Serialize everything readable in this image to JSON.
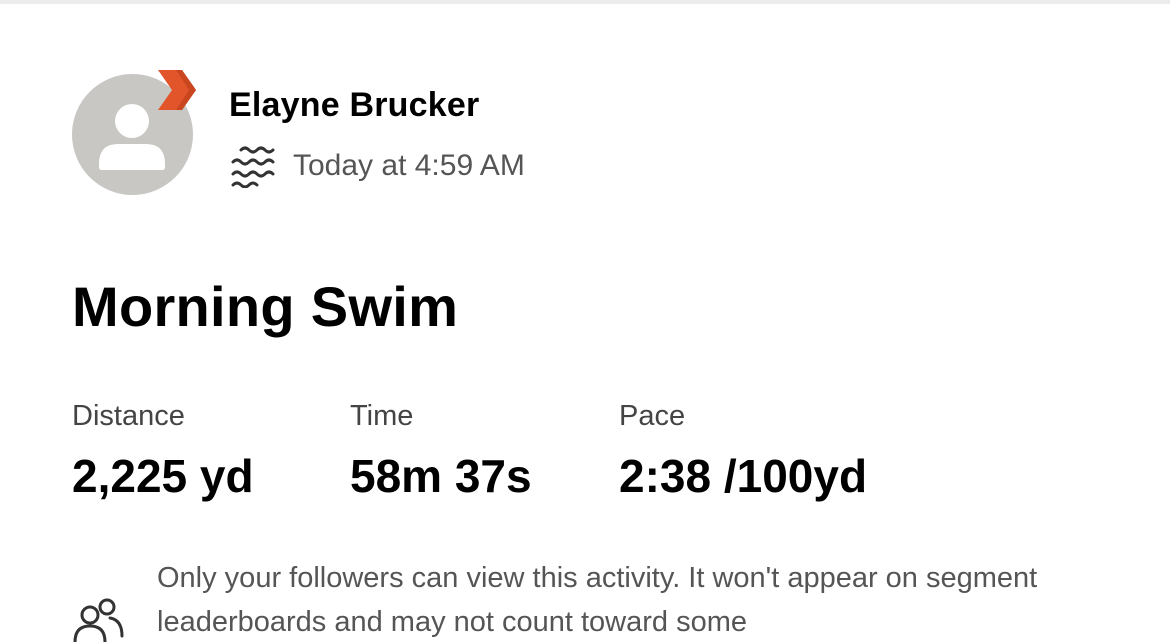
{
  "user": {
    "name": "Elayne Brucker"
  },
  "activity": {
    "timestamp": "Today at 4:59 AM",
    "sport_icon": "swim-icon",
    "title": "Morning Swim"
  },
  "stats": [
    {
      "label": "Distance",
      "value": "2,225 yd"
    },
    {
      "label": "Time",
      "value": "58m 37s"
    },
    {
      "label": "Pace",
      "value": "2:38 /100yd"
    }
  ],
  "privacy": {
    "icon": "followers-icon",
    "text": "Only your followers can view this activity. It won't appear on segment leaderboards and may not count toward some"
  },
  "colors": {
    "avatar_bg": "#c8c7c4",
    "badge_orange": "#e2552a",
    "badge_orange_dark": "#c9461f",
    "secondary_text": "#555555"
  }
}
